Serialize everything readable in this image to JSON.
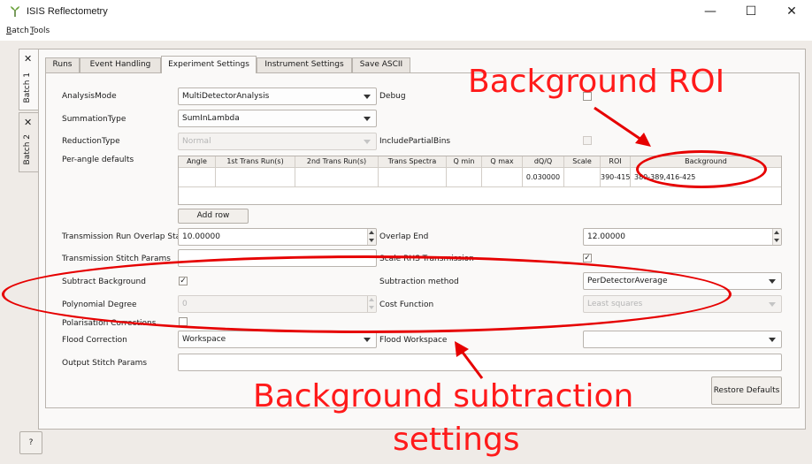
{
  "window": {
    "title": "ISIS Reflectometry",
    "minimize_glyph": "—",
    "maximize_glyph": "☐",
    "close_glyph": "✕"
  },
  "menubar": {
    "batch_first": "B",
    "batch_rest": "atch",
    "tools_first": "T",
    "tools_rest": "ools"
  },
  "side_tabs": [
    {
      "label": "Batch 1",
      "close": "✕"
    },
    {
      "label": "Batch 2",
      "close": "✕"
    }
  ],
  "tabs": [
    "Runs",
    "Event Handling",
    "Experiment Settings",
    "Instrument Settings",
    "Save ASCII"
  ],
  "active_tab": "Experiment Settings",
  "form": {
    "analysis_mode": {
      "label": "AnalysisMode",
      "value": "MultiDetectorAnalysis"
    },
    "summation_type": {
      "label": "SummationType",
      "value": "SumInLambda"
    },
    "reduction_type": {
      "label": "ReductionType",
      "value": "Normal"
    },
    "debug": {
      "label": "Debug",
      "checked": false
    },
    "include_partial_bins": {
      "label": "IncludePartialBins",
      "checked": false
    },
    "per_angle": {
      "label": "Per-angle defaults",
      "columns": [
        "Angle",
        "1st Trans Run(s)",
        "2nd Trans Run(s)",
        "Trans Spectra",
        "Q min",
        "Q max",
        "dQ/Q",
        "Scale",
        "ROI",
        "Background"
      ],
      "rows": [
        [
          "",
          "",
          "",
          "",
          "",
          "",
          "0.030000",
          "",
          "390-415",
          "380-389,416-425"
        ]
      ],
      "add_row": "Add row"
    },
    "trans_overlap_start": {
      "label": "Transmission Run Overlap Start",
      "value": "10.00000"
    },
    "overlap_end": {
      "label": "Overlap End",
      "value": "12.00000"
    },
    "trans_stitch_params": {
      "label": "Transmission Stitch Params",
      "value": ""
    },
    "scale_rhs_transmission": {
      "label": "Scale RHS Transmission",
      "checked": true
    },
    "subtract_background": {
      "label": "Subtract Background",
      "checked": true
    },
    "subtraction_method": {
      "label": "Subtraction method",
      "value": "PerDetectorAverage"
    },
    "polynomial_degree": {
      "label": "Polynomial Degree",
      "value": "0"
    },
    "cost_function": {
      "label": "Cost Function",
      "value": "Least squares"
    },
    "polarisation_corrections": {
      "label": "Polarisation Corrections",
      "checked": false
    },
    "flood_correction": {
      "label": "Flood Correction",
      "value": "Workspace"
    },
    "flood_workspace": {
      "label": "Flood Workspace",
      "value": ""
    },
    "output_stitch_params": {
      "label": "Output Stitch Params",
      "value": ""
    },
    "restore_defaults": "Restore Defaults"
  },
  "help_button": "?",
  "annotations": {
    "background_roi": "Background ROI",
    "background_subtraction_line1": "Background subtraction",
    "background_subtraction_line2": "settings",
    "color": "#ff1a1a"
  },
  "colors": {
    "app_background": "#efebe7",
    "panel_background": "#faf9f8",
    "annotation_red": "#e60000"
  },
  "check_glyph": "✓"
}
